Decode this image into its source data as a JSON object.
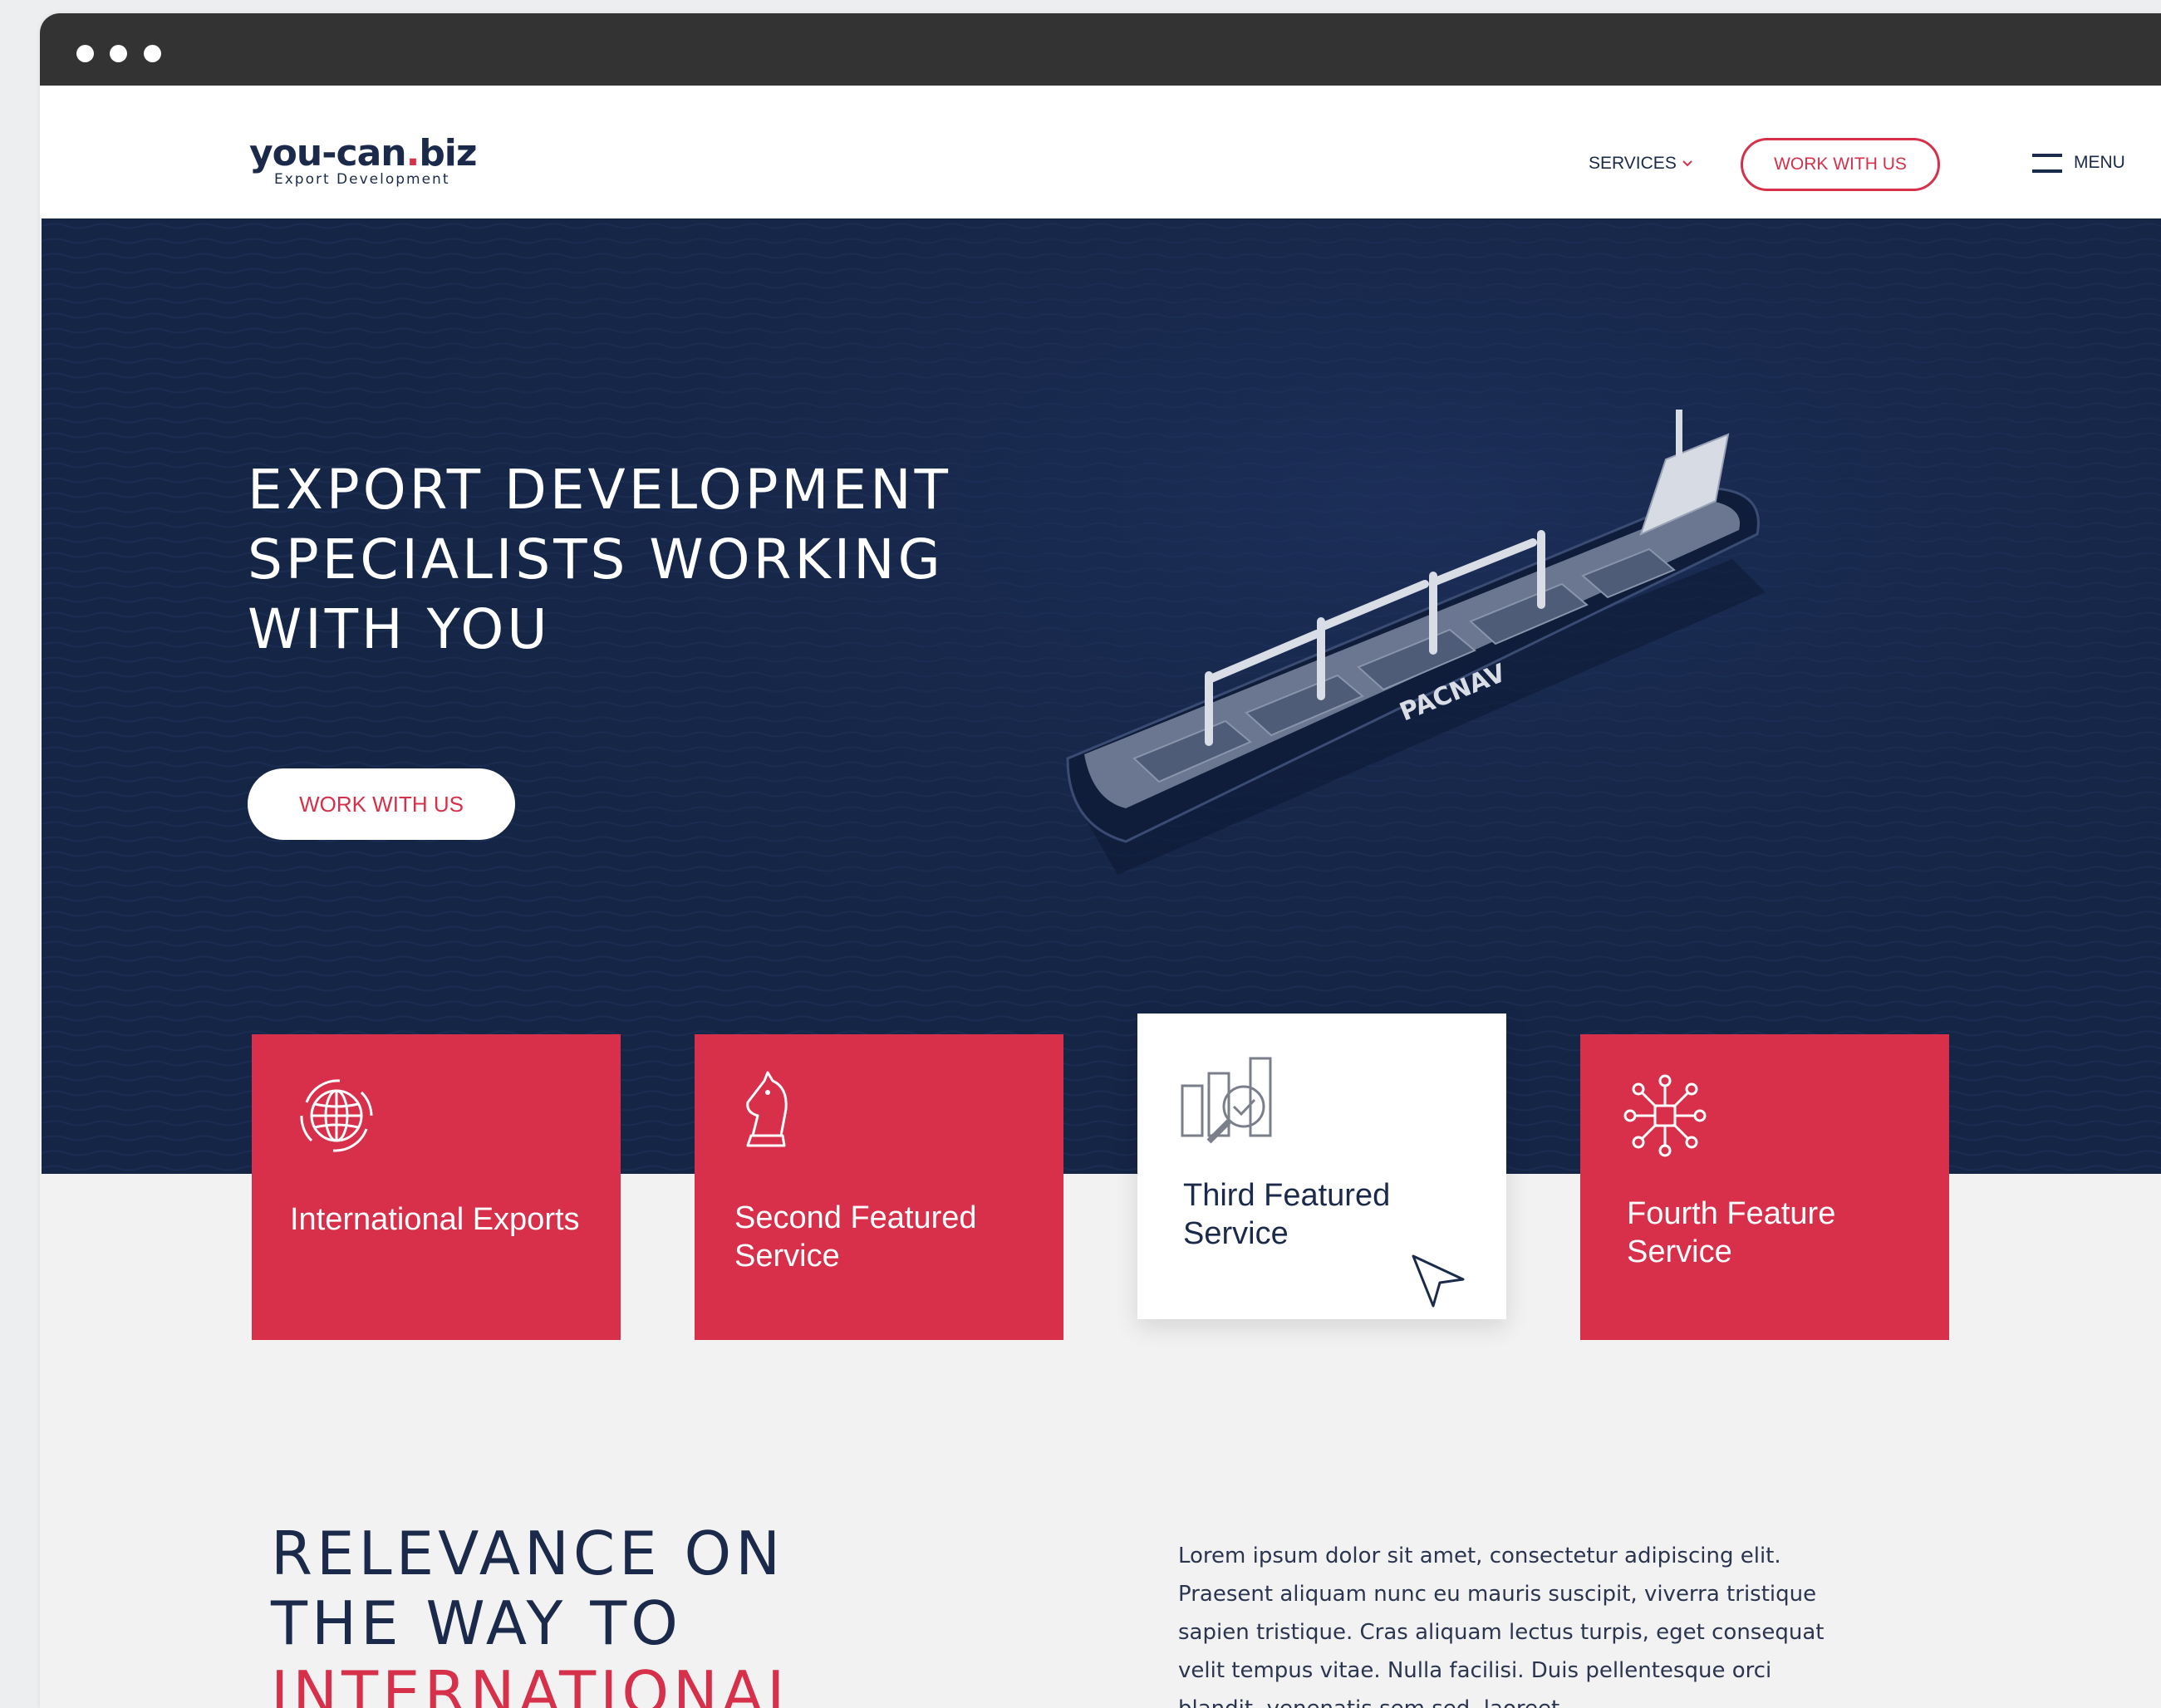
{
  "window": {
    "dots": 3
  },
  "nav": {
    "logo_main_a": "you-can",
    "logo_main_b": ".",
    "logo_main_c": "biz",
    "logo_sub": "Export Development",
    "services_label": "SERVICES",
    "cta_label": "WORK WITH US",
    "menu_label": "MENU"
  },
  "hero": {
    "title_lines": [
      "EXPORT DEVELOPMENT",
      "SPECIALISTS WORKING",
      "WITH YOU"
    ],
    "button_label": "WORK WITH US",
    "ship_name": "PACNAV"
  },
  "cards": [
    {
      "label": "International Exports",
      "icon": "globe-arrows-icon"
    },
    {
      "label": "Second Featured Service",
      "icon": "chess-knight-icon"
    },
    {
      "label": "Third Featured Service",
      "icon": "chart-magnifier-icon"
    },
    {
      "label": "Fourth Feature Service",
      "icon": "network-nodes-icon"
    }
  ],
  "section": {
    "title_line1": "RELEVANCE ON",
    "title_line2": "THE WAY TO",
    "title_line3": "INTERNATIONAL",
    "body": "Lorem ipsum dolor sit amet, consectetur adipiscing elit. Praesent aliquam nunc eu mauris suscipit, viverra tristique sapien tristique. Cras aliquam lectus turpis, eget consequat velit tempus vitae. Nulla facilisi. Duis pellentesque orci blandit, venenatis sem sed, laoreet"
  },
  "colors": {
    "navy": "#1b2a4a",
    "accent": "#d6304a",
    "hero_bg": "#152546"
  }
}
